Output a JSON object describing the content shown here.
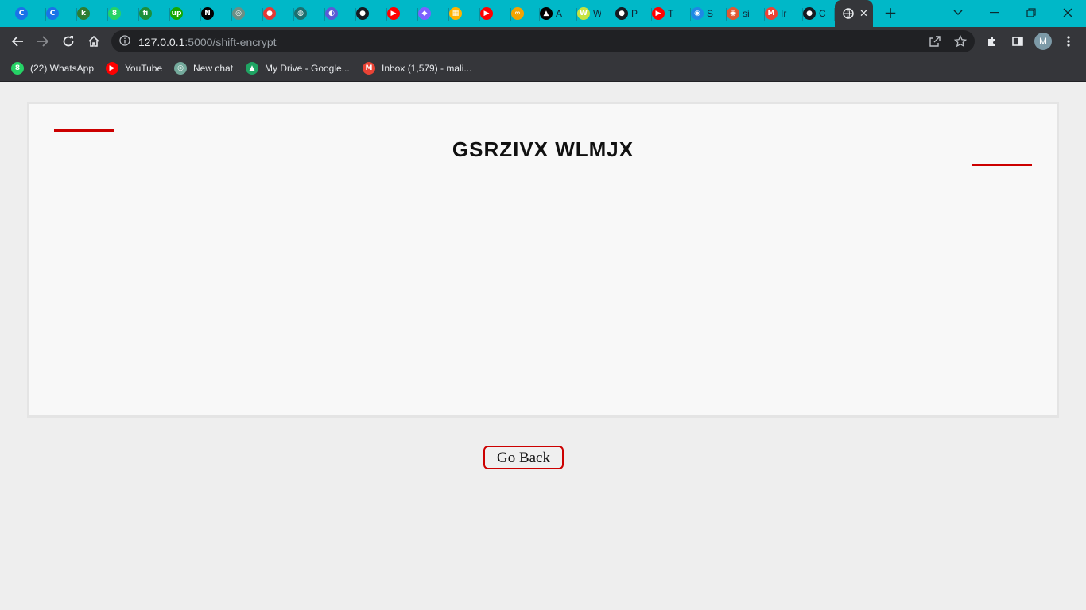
{
  "browser": {
    "tabs": [
      {
        "icon": "c-circle-icon",
        "color": "#1a73e8",
        "glyph": "C"
      },
      {
        "icon": "c-circle-icon",
        "color": "#1a73e8",
        "glyph": "C"
      },
      {
        "icon": "leetcode-like-icon",
        "color": "#2e7d32",
        "glyph": "k"
      },
      {
        "icon": "whatsapp-icon",
        "color": "#25d366",
        "glyph": "8"
      },
      {
        "icon": "fi-icon",
        "color": "#1b8f3a",
        "glyph": "fi"
      },
      {
        "icon": "upwork-icon",
        "color": "#14a800",
        "glyph": "up"
      },
      {
        "icon": "nextjs-icon",
        "color": "#000000",
        "glyph": "N"
      },
      {
        "icon": "chatgpt-icon",
        "color": "#6b8f86",
        "glyph": "◎"
      },
      {
        "icon": "record-icon",
        "color": "#e53935",
        "glyph": "●"
      },
      {
        "icon": "bird-icon",
        "color": "#1d6f6f",
        "glyph": "◍"
      },
      {
        "icon": "messenger-icon",
        "color": "#5b5bd6",
        "glyph": "◐"
      },
      {
        "icon": "github-icon",
        "color": "#161b22",
        "glyph": "●"
      },
      {
        "icon": "youtube-icon",
        "color": "#ff0000",
        "glyph": "▶"
      },
      {
        "icon": "fluent-icon",
        "color": "#7b61ff",
        "glyph": "◆"
      },
      {
        "icon": "colorful-icon",
        "color": "#ffb300",
        "glyph": "▦"
      },
      {
        "icon": "youtube-icon",
        "color": "#ff0000",
        "glyph": "▶"
      },
      {
        "icon": "infinity-icon",
        "color": "#f4a300",
        "glyph": "∞"
      },
      {
        "icon": "a-triangle-icon",
        "color": "#000000",
        "glyph": "▲",
        "title": "A"
      },
      {
        "icon": "w-box-icon",
        "color": "#c6e33f",
        "glyph": "W",
        "title": "W"
      },
      {
        "icon": "github-icon",
        "color": "#161b22",
        "glyph": "●",
        "title": "P"
      },
      {
        "icon": "youtube-icon",
        "color": "#ff0000",
        "glyph": "▶",
        "title": "T"
      },
      {
        "icon": "globe-icon",
        "color": "#1e88e5",
        "glyph": "◉",
        "title": "S"
      },
      {
        "icon": "duckduckgo-icon",
        "color": "#de5833",
        "glyph": "◉",
        "title": "si"
      },
      {
        "icon": "gmail-icon",
        "color": "#ea4335",
        "glyph": "M",
        "title": "Ir"
      },
      {
        "icon": "github-icon",
        "color": "#161b22",
        "glyph": "●",
        "title": "C"
      }
    ],
    "address": {
      "host": "127.0.0.1",
      "path": ":5000/shift-encrypt"
    },
    "profile_initial": "M",
    "bookmarks": [
      {
        "label": "(22) WhatsApp",
        "icon": "whatsapp-icon",
        "color": "#25d366",
        "glyph": "8"
      },
      {
        "label": "YouTube",
        "icon": "youtube-icon",
        "color": "#ff0000",
        "glyph": "▶"
      },
      {
        "label": "New chat",
        "icon": "chatgpt-icon",
        "color": "#74aa9c",
        "glyph": "◎"
      },
      {
        "label": "My Drive - Google...",
        "icon": "google-drive-icon",
        "color": "#1fa463",
        "glyph": "▲"
      },
      {
        "label": "Inbox (1,579) - mali...",
        "icon": "gmail-icon",
        "color": "#ea4335",
        "glyph": "M"
      }
    ]
  },
  "page": {
    "title": "GSRZIVX WLMJX",
    "go_back_label": "Go Back",
    "accent_color": "#cc0000"
  }
}
